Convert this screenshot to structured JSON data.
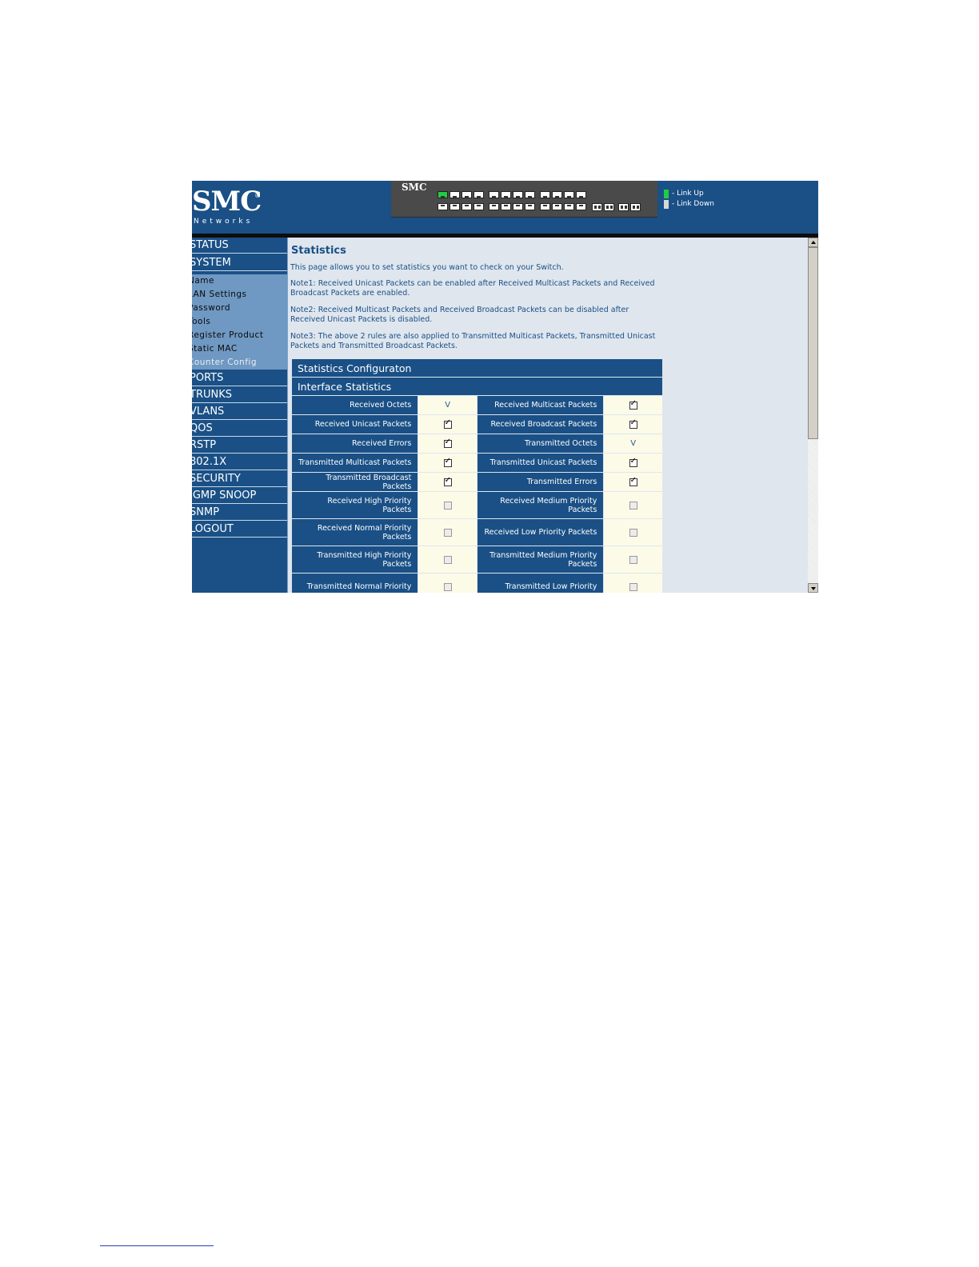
{
  "header": {
    "logo_text": "SMC",
    "logo_reg": "®",
    "logo_sub": "Networks",
    "panel_brand": "SMC",
    "legend": [
      {
        "label": "- Link Up",
        "color": "#22cc44"
      },
      {
        "label": "- Link Down",
        "color": "#d8d8d8"
      }
    ]
  },
  "sidebar": {
    "items_top": [
      "STATUS",
      "SYSTEM"
    ],
    "sub_items": [
      "Name",
      "LAN Settings",
      "Password",
      "Tools",
      "Register Product",
      "Static MAC",
      "Counter Config"
    ],
    "items_bottom": [
      "PORTS",
      "TRUNKS",
      "VLANS",
      "QOS",
      "RSTP",
      "802.1X",
      "SECURITY",
      "IGMP SNOOP",
      "SNMP",
      "LOGOUT"
    ]
  },
  "content": {
    "title": "Statistics",
    "intro": "This page allows you to set statistics you want to check on your Switch.",
    "note1": "Note1: Received Unicast Packets can be enabled after Received Multicast Packets and Received Broadcast Packets are enabled.",
    "note2": "Note2: Received Multicast Packets and Received Broadcast Packets can be disabled after Received Unicast Packets is disabled.",
    "note3": "Note3: The above 2 rules are also applied to Transmitted Multicast Packets, Transmitted Unicast Packets and Transmitted Broadcast Packets.",
    "table_title": "Statistics Configuraton",
    "section_title": "Interface Statistics",
    "rows": [
      [
        {
          "label": "Received Octets",
          "state": "fixed",
          "mark": "V"
        },
        {
          "label": "Received Multicast Packets",
          "state": "checked"
        }
      ],
      [
        {
          "label": "Received Unicast Packets",
          "state": "checked"
        },
        {
          "label": "Received Broadcast Packets",
          "state": "checked"
        }
      ],
      [
        {
          "label": "Received Errors",
          "state": "checked"
        },
        {
          "label": "Transmitted Octets",
          "state": "fixed",
          "mark": "V"
        }
      ],
      [
        {
          "label": "Transmitted Multicast Packets",
          "state": "checked"
        },
        {
          "label": "Transmitted Unicast Packets",
          "state": "checked"
        }
      ],
      [
        {
          "label": "Transmitted Broadcast Packets",
          "state": "checked"
        },
        {
          "label": "Transmitted Errors",
          "state": "checked"
        }
      ],
      [
        {
          "label": "Received High Priority Packets",
          "state": "unchecked"
        },
        {
          "label": "Received Medium Priority Packets",
          "state": "unchecked"
        }
      ],
      [
        {
          "label": "Received Normal Priority Packets",
          "state": "unchecked"
        },
        {
          "label": "Received Low Priority Packets",
          "state": "unchecked"
        }
      ],
      [
        {
          "label": "Transmitted High Priority Packets",
          "state": "unchecked"
        },
        {
          "label": "Transmitted Medium Priority Packets",
          "state": "unchecked"
        }
      ],
      [
        {
          "label": "Transmitted Normal Priority",
          "state": "unchecked"
        },
        {
          "label": "Transmitted Low Priority",
          "state": "unchecked"
        }
      ]
    ]
  },
  "colors": {
    "brand": "#1a5086",
    "content_bg": "#dfe6ee",
    "cell_bg": "#fbfbe8"
  }
}
